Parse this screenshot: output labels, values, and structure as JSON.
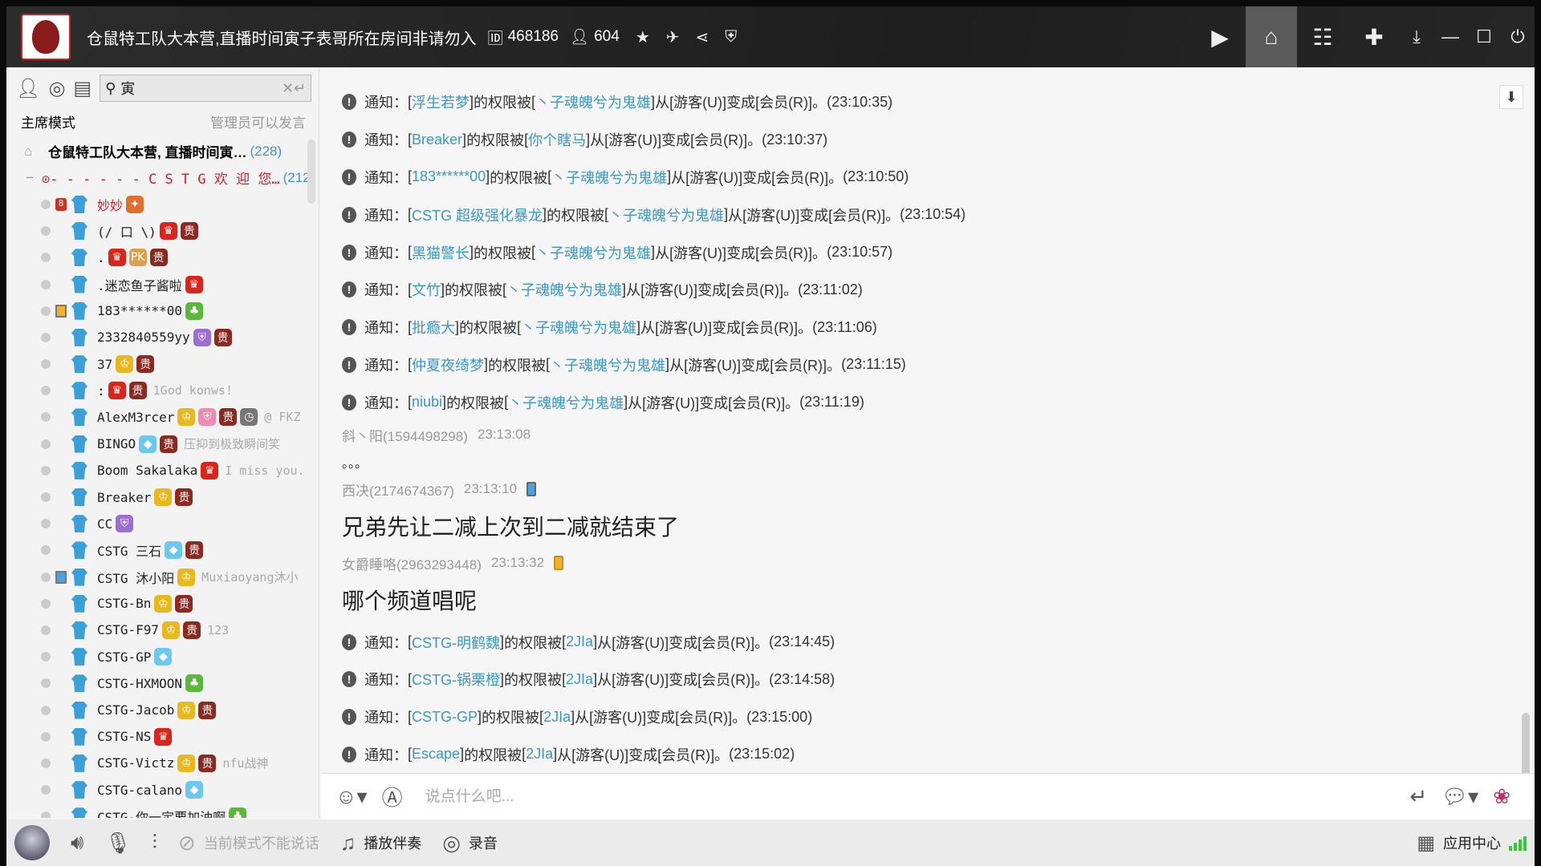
{
  "window": {
    "title": "仓鼠特工队大本营,直播时间寅子表哥所在房间非请勿入",
    "room_id": "468186",
    "online_count": "604",
    "icons": [
      "video-icon",
      "home-icon",
      "list-icon",
      "gamepad-icon",
      "minimize-to-tray-icon",
      "minimize-icon",
      "maximize-icon",
      "power-icon"
    ]
  },
  "sidebar": {
    "search_value": "寅",
    "mode_label": "主席模式",
    "mode_note": "管理员可以发言",
    "channel": {
      "name": "仓鼠特工队大本营, 直播时间寅…",
      "count": "(228)"
    },
    "subchannel": {
      "name": "⊙- - - - - -  C S T G 欢 迎 您…",
      "count": "(212)"
    },
    "users": [
      {
        "name": "妙妙",
        "red": true,
        "pre": "8",
        "badges": [
          "eagle"
        ]
      },
      {
        "name": "(/ 口 \\)",
        "badges": [
          "crown",
          "gui"
        ]
      },
      {
        "name": ".",
        "badges": [
          "crown",
          "pk",
          "gui"
        ]
      },
      {
        "name": ".迷恋鱼子酱啦",
        "badges": [
          "crown"
        ]
      },
      {
        "name": "183******00",
        "device": "pad",
        "badges": [
          "leaf"
        ]
      },
      {
        "name": "2332840559yy",
        "badges": [
          "shield",
          "gui"
        ]
      },
      {
        "name": "37",
        "badges": [
          "gold",
          "gui"
        ]
      },
      {
        "name": ":",
        "badges": [
          "crown",
          "gui"
        ],
        "status": "1God konws!"
      },
      {
        "name": "AlexM3rcer",
        "badges": [
          "gold",
          "pinkshield",
          "gui",
          "clock"
        ],
        "status": "@ FKZ"
      },
      {
        "name": "BINGO",
        "badges": [
          "diamond",
          "gui"
        ],
        "status": "压抑到极致瞬间笑"
      },
      {
        "name": "Boom Sakalaka",
        "badges": [
          "crown"
        ],
        "status": "I miss you."
      },
      {
        "name": "Breaker",
        "badges": [
          "gold",
          "gui"
        ]
      },
      {
        "name": "CC",
        "badges": [
          "shield"
        ]
      },
      {
        "name": "CSTG 三石",
        "badges": [
          "diamond",
          "gui"
        ]
      },
      {
        "name": "CSTG 沐小阳",
        "device": "phone",
        "badges": [
          "gold"
        ],
        "status": "Muxiaoyang沐小"
      },
      {
        "name": "CSTG-Bn",
        "badges": [
          "gold",
          "gui"
        ]
      },
      {
        "name": "CSTG-F97",
        "badges": [
          "gold",
          "gui"
        ],
        "status": "123"
      },
      {
        "name": "CSTG-GP",
        "badges": [
          "diamond"
        ]
      },
      {
        "name": "CSTG-HXMOON",
        "badges": [
          "leaf"
        ]
      },
      {
        "name": "CSTG-Jacob",
        "badges": [
          "gold",
          "gui"
        ]
      },
      {
        "name": "CSTG-NS",
        "badges": [
          "crown"
        ]
      },
      {
        "name": "CSTG-Victz",
        "badges": [
          "gold",
          "gui"
        ],
        "status": "nfu战神"
      },
      {
        "name": "CSTG-calano",
        "badges": [
          "diamond"
        ]
      },
      {
        "name": "CSTG-你一定要加油啊",
        "badges": [
          "leaf"
        ]
      }
    ]
  },
  "notice_text": {
    "prefix": "通知：",
    "mid": "的权限被",
    "from": "从",
    "old_role": "[游客(U)]",
    "to": "变成",
    "new_role": "[会员(R)]。"
  },
  "chat": [
    {
      "type": "notice",
      "user": "浮生若梦",
      "op": "丶子魂魄兮为鬼雄",
      "time": "23:10:35"
    },
    {
      "type": "notice",
      "user": "Breaker",
      "op": "你个瞎马",
      "time": "23:10:37"
    },
    {
      "type": "notice",
      "user": "183******00",
      "op": "丶子魂魄兮为鬼雄",
      "time": "23:10:50"
    },
    {
      "type": "notice",
      "user": "CSTG 超级强化暴龙",
      "op": "丶子魂魄兮为鬼雄",
      "time": "23:10:54"
    },
    {
      "type": "notice",
      "user": "黑猫警长",
      "op": "丶子魂魄兮为鬼雄",
      "time": "23:10:57"
    },
    {
      "type": "notice",
      "user": "文竹",
      "op": "丶子魂魄兮为鬼雄",
      "time": "23:11:02"
    },
    {
      "type": "notice",
      "user": "批瘾大",
      "op": "丶子魂魄兮为鬼雄",
      "time": "23:11:06"
    },
    {
      "type": "notice",
      "user": "仲夏夜绮梦",
      "op": "丶子魂魄兮为鬼雄",
      "time": "23:11:15"
    },
    {
      "type": "notice",
      "user": "niubi",
      "op": "丶子魂魄兮为鬼雄",
      "time": "23:11:19"
    },
    {
      "type": "msg",
      "sender": "斜丶阳(1594498298)",
      "time": "23:13:08",
      "text": "。。。",
      "small": true
    },
    {
      "type": "msg",
      "sender": "西决(2174674367)",
      "time": "23:13:10",
      "device": "phone",
      "text": "兄弟先让二减上次到二减就结束了"
    },
    {
      "type": "msg",
      "sender": "女爵睡咯(2963293448)",
      "time": "23:13:32",
      "device": "pad",
      "text": "哪个频道唱呢"
    },
    {
      "type": "notice",
      "user": "CSTG-明鹤魏",
      "op": "2JIa",
      "time": "23:14:45"
    },
    {
      "type": "notice",
      "user": "CSTG-锅栗橙",
      "op": "2JIa",
      "time": "23:14:58"
    },
    {
      "type": "notice",
      "user": "CSTG-GP",
      "op": "2JIa",
      "time": "23:15:00"
    },
    {
      "type": "notice",
      "user": "Escape",
      "op": "2JIa",
      "time": "23:15:02"
    }
  ],
  "input": {
    "placeholder": "说点什么吧..."
  },
  "bottom": {
    "mode_disabled": "当前模式不能说话",
    "play_music": "播放伴奏",
    "record": "录音",
    "app_center": "应用中心"
  },
  "colors": {
    "link": "#3a98c9",
    "titlebar": "#2a2a2a",
    "accent_red": "#d0202a"
  }
}
